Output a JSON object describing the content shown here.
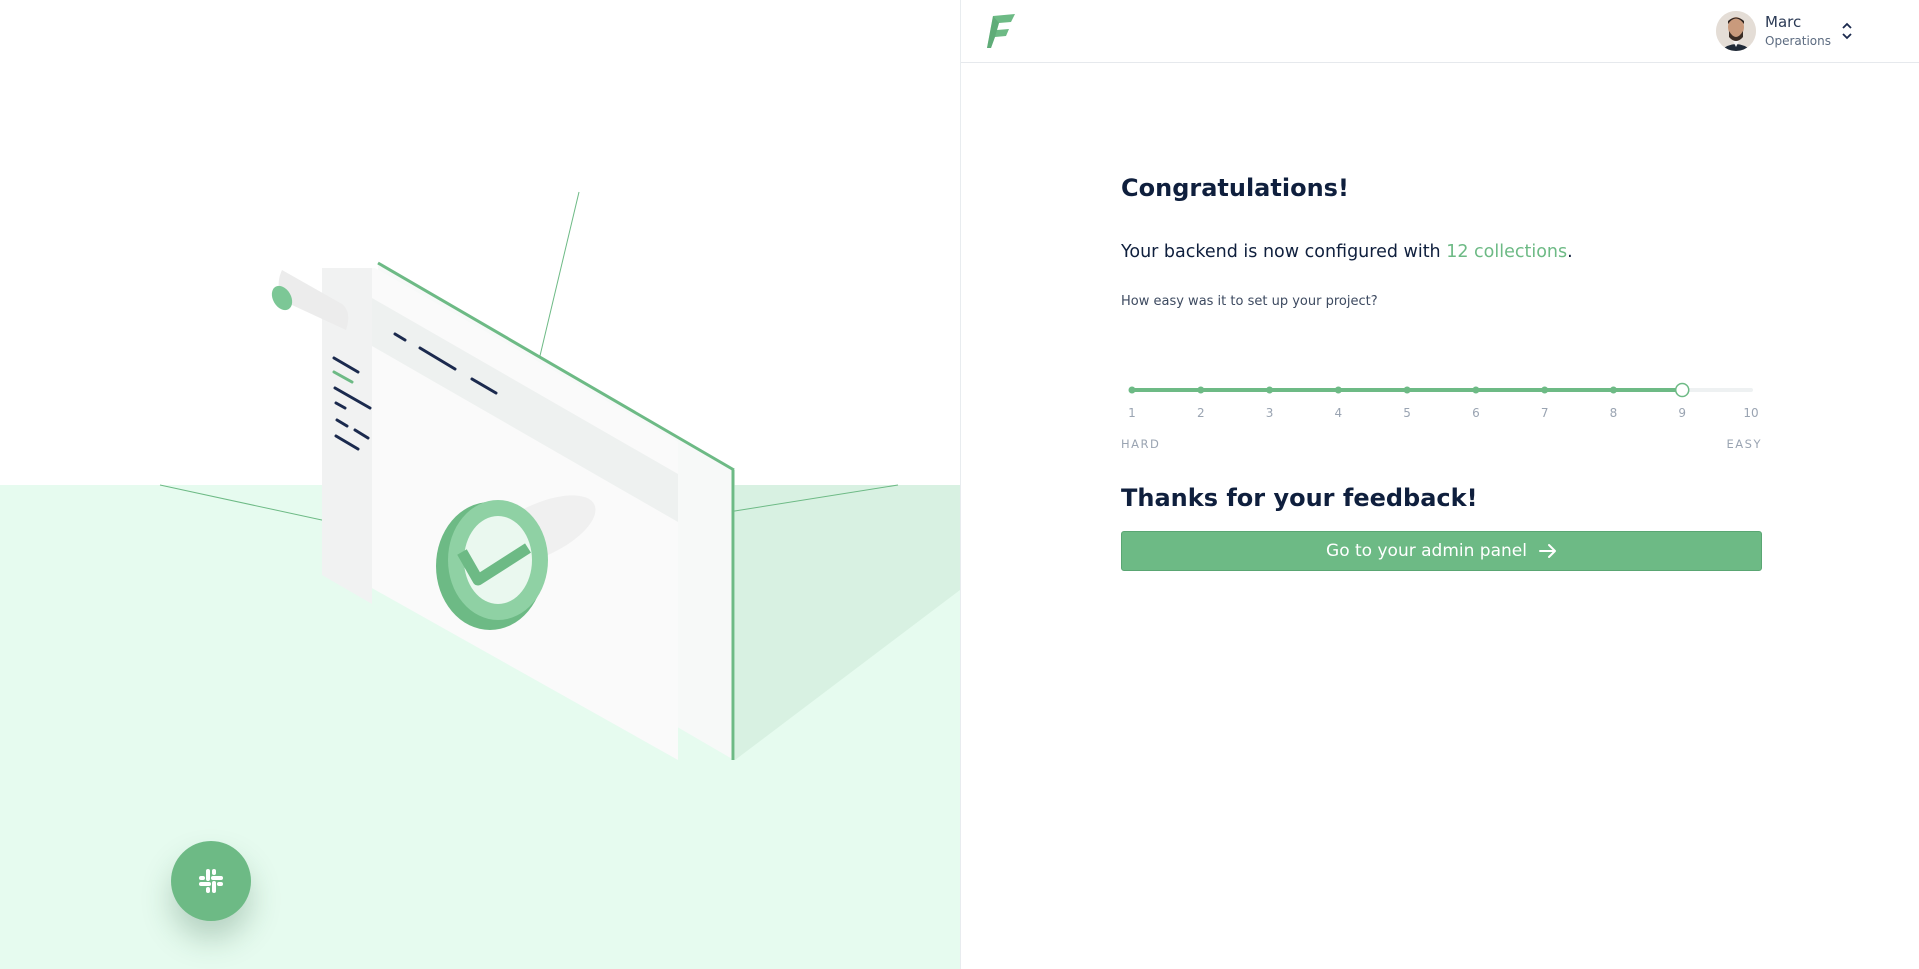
{
  "user": {
    "name": "Marc",
    "role": "Operations"
  },
  "main": {
    "title": "Congratulations!",
    "sub_prefix": "Your backend is now configured with ",
    "sub_highlight": "12 collections",
    "sub_suffix": ".",
    "question": "How easy was it to set up your project?",
    "rating": {
      "min": 1,
      "max": 10,
      "selected": 9,
      "ticks": [
        "1",
        "2",
        "3",
        "4",
        "5",
        "6",
        "7",
        "8",
        "9",
        "10"
      ]
    },
    "label_hard": "HARD",
    "label_easy": "EASY",
    "thanks": "Thanks for your feedback!",
    "admin_button": "Go to your admin panel"
  },
  "colors": {
    "accent": "#6dba85",
    "text": "#0f1f3d",
    "floor": "#e6fbef"
  },
  "icons": {
    "logo": "f-logo-icon",
    "slack": "slack-icon",
    "chevron": "chevron-up-down-icon",
    "arrow": "arrow-right-icon"
  }
}
